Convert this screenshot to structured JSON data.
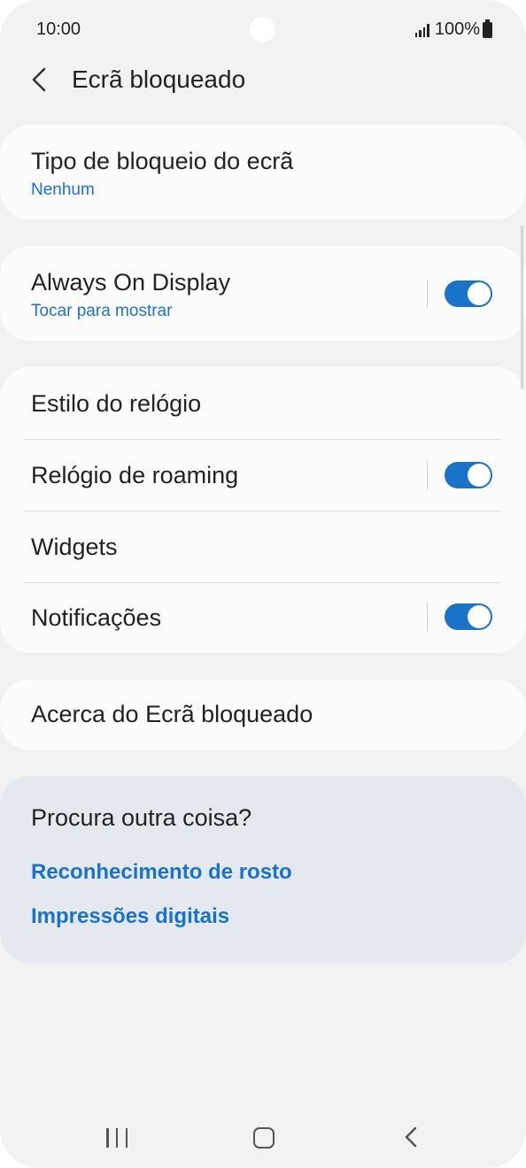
{
  "status_bar": {
    "time": "10:00",
    "battery": "100%",
    "icons": [
      "signal-icon",
      "battery-icon"
    ]
  },
  "header": {
    "title": "Ecrã bloqueado",
    "back_icon": "chevron-left-icon"
  },
  "settings": {
    "lock_type": {
      "title": "Tipo de bloqueio do ecrã",
      "subtitle": "Nenhum"
    },
    "always_on": {
      "title": "Always On Display",
      "subtitle": "Tocar para mostrar",
      "enabled": true
    },
    "clock_style": {
      "title": "Estilo do relógio"
    },
    "roaming_clock": {
      "title": "Relógio de roaming",
      "enabled": true
    },
    "widgets": {
      "title": "Widgets"
    },
    "notifications": {
      "title": "Notificações",
      "enabled": true
    },
    "about": {
      "title": "Acerca do Ecrã bloqueado"
    }
  },
  "suggestions": {
    "title": "Procura outra coisa?",
    "links": [
      "Reconhecimento de rosto",
      "Impressões digitais"
    ]
  },
  "nav_bar": {
    "icons": [
      "recent-apps-icon",
      "home-icon",
      "back-icon"
    ]
  },
  "colors": {
    "accent": "#1a73c9",
    "background": "#f2f2f2",
    "card": "#fcfcfc",
    "suggest_bg": "#e4e9ef"
  }
}
